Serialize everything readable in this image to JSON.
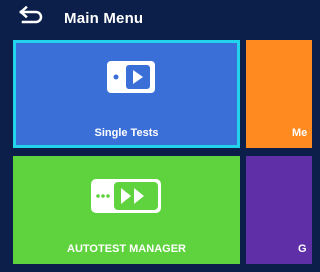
{
  "header": {
    "title": "Main Menu",
    "back_icon": "back-arrow-icon"
  },
  "tiles": [
    {
      "label": "Single Tests",
      "color": "#3a6fd8",
      "selected": true,
      "icon": "single-test-icon"
    },
    {
      "label": "Me",
      "color": "#ff8a1f",
      "selected": false
    },
    {
      "label": "AUTOTEST MANAGER",
      "color": "#5ed33d",
      "selected": false,
      "icon": "autotest-icon"
    },
    {
      "label": "G",
      "color": "#5e2fa6",
      "selected": false
    }
  ],
  "colors": {
    "background": "#0b1f4a",
    "selection_border": "#22d3ee"
  }
}
